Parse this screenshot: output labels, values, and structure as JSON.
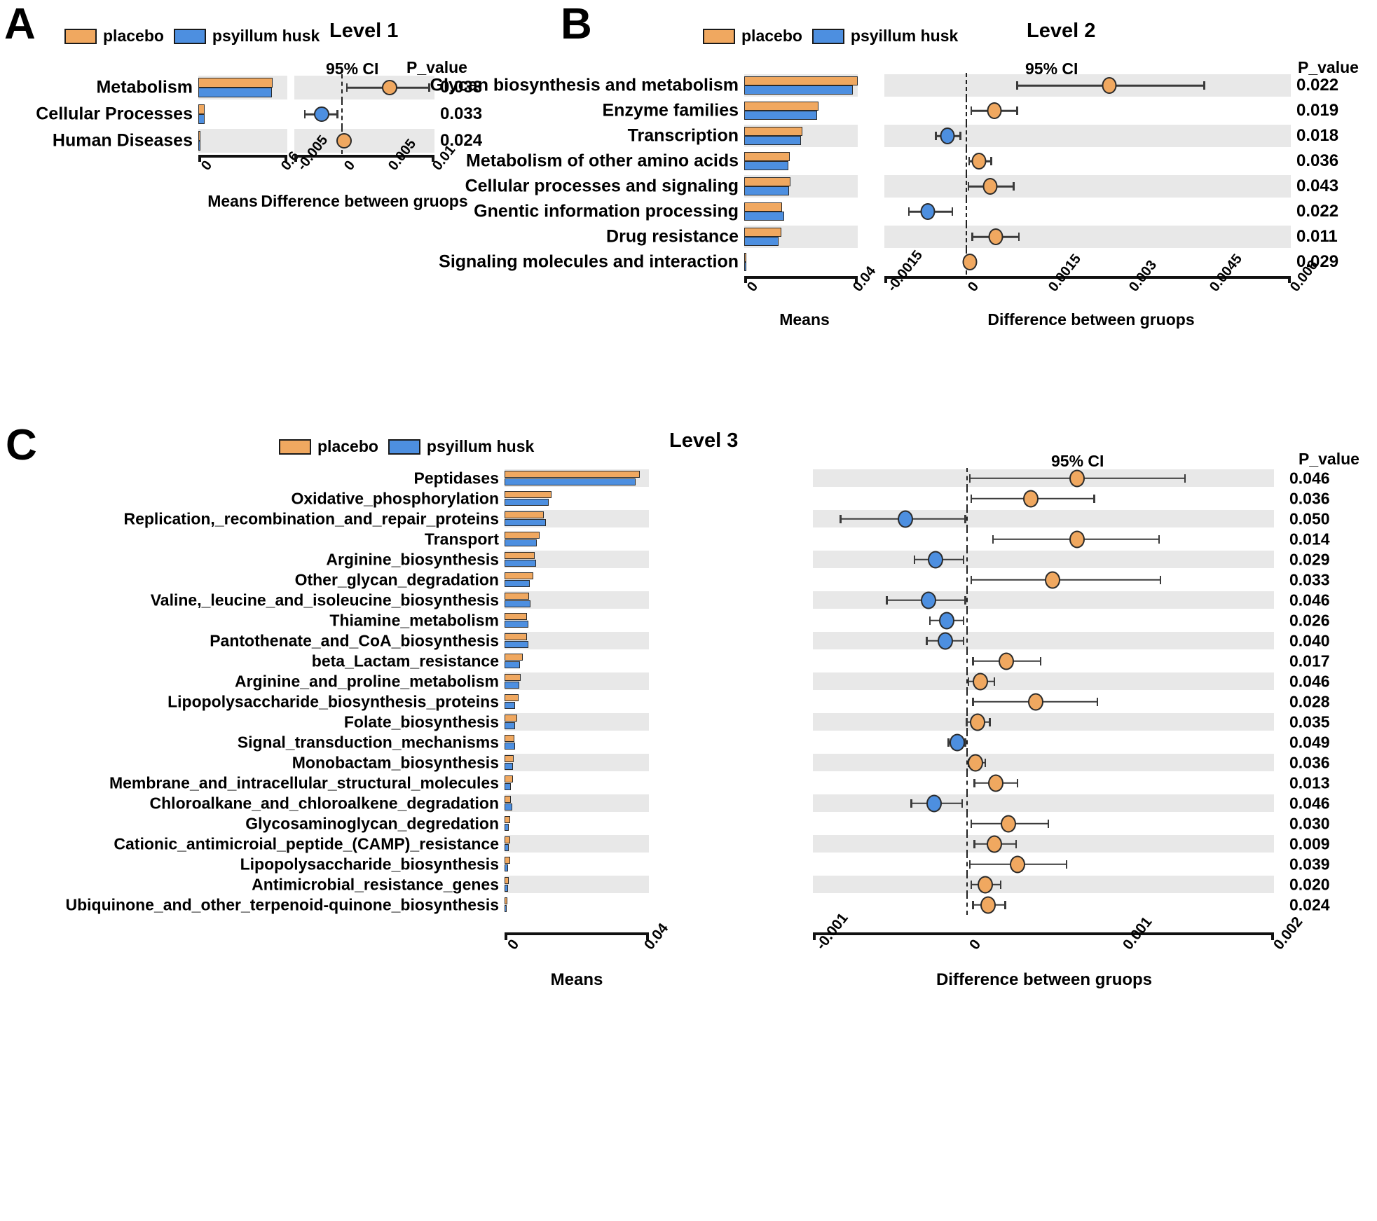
{
  "legend": {
    "placebo": "placebo",
    "psyllium": "psyillum husk",
    "color_placebo": "#F0A860",
    "color_psyllium": "#4D8FE0"
  },
  "labels": {
    "ci_header": "95% CI",
    "p_header": "P_value",
    "means_axis": "Means",
    "diff_axis": "Difference between gruops"
  },
  "panels": {
    "a": {
      "letter": "A",
      "title": "Level 1"
    },
    "b": {
      "letter": "B",
      "title": "Level 2"
    },
    "c": {
      "letter": "C",
      "title": "Level 3"
    }
  },
  "chart_data": [
    {
      "type": "bar",
      "id": "panel-a",
      "title": "Level 1",
      "xlabel": "Means",
      "xlabel2": "Difference between gruops",
      "legend": [
        "placebo",
        "psyillum husk"
      ],
      "means_xlim": [
        0,
        0.6
      ],
      "means_ticks": [
        "0",
        "0.6"
      ],
      "diff_xlim": [
        -0.005,
        0.01
      ],
      "diff_ticks": [
        "-0.005",
        "0",
        "0.005",
        "0.01"
      ],
      "categories": [
        "Metabolism",
        "Cellular Processes",
        "Human Diseases"
      ],
      "series": [
        {
          "name": "placebo",
          "values": [
            0.5,
            0.041,
            0.01
          ]
        },
        {
          "name": "psyillum husk",
          "values": [
            0.495,
            0.043,
            0.008
          ]
        }
      ],
      "effects": [
        {
          "category": "Metabolism",
          "diff": 0.0052,
          "ci_low": 0.0006,
          "ci_high": 0.0094,
          "enriched_in": "placebo",
          "p_value": "0.033"
        },
        {
          "category": "Cellular Processes",
          "diff": -0.0021,
          "ci_low": -0.0039,
          "ci_high": -0.0004,
          "enriched_in": "psyillum husk",
          "p_value": "0.033"
        },
        {
          "category": "Human Diseases",
          "diff": 0.0003,
          "ci_low": 0.0002,
          "ci_high": 0.0004,
          "enriched_in": "placebo",
          "p_value": "0.024"
        }
      ]
    },
    {
      "type": "bar",
      "id": "panel-b",
      "title": "Level 2",
      "xlabel": "Means",
      "xlabel2": "Difference between gruops",
      "legend": [
        "placebo",
        "psyillum husk"
      ],
      "means_xlim": [
        0,
        0.04
      ],
      "means_ticks": [
        "0",
        "0.04"
      ],
      "diff_xlim": [
        -0.0015,
        0.006
      ],
      "diff_ticks": [
        "-0.0015",
        "0",
        "0.0015",
        "0.003",
        "0.0045",
        "0.006"
      ],
      "categories": [
        "Glycan biosynthesis and metabolism",
        "Enzyme families",
        "Transcription",
        "Metabolism of other amino acids",
        "Cellular processes and signaling",
        "Gnentic information processing",
        "Drug resistance",
        "Signaling molecules and interaction"
      ],
      "series": [
        {
          "name": "placebo",
          "values": [
            0.04,
            0.0262,
            0.0205,
            0.016,
            0.0162,
            0.0133,
            0.013,
            0.0008
          ]
        },
        {
          "name": "psyillum husk",
          "values": [
            0.0382,
            0.0258,
            0.02,
            0.0155,
            0.0158,
            0.014,
            0.0122,
            0.0007
          ]
        }
      ],
      "effects": [
        {
          "category": "Glycan biosynthesis and metabolism",
          "diff": 0.00265,
          "ci_low": 0.00095,
          "ci_high": 0.0044,
          "enriched_in": "placebo",
          "p_value": "0.022"
        },
        {
          "category": "Enzyme families",
          "diff": 0.00053,
          "ci_low": 0.0001,
          "ci_high": 0.00095,
          "enriched_in": "placebo",
          "p_value": "0.019"
        },
        {
          "category": "Transcription",
          "diff": -0.00034,
          "ci_low": -0.00055,
          "ci_high": -0.0001,
          "enriched_in": "psyillum husk",
          "p_value": "0.018"
        },
        {
          "category": "Metabolism of other amino acids",
          "diff": 0.00025,
          "ci_low": 6e-05,
          "ci_high": 0.00047,
          "enriched_in": "placebo",
          "p_value": "0.036"
        },
        {
          "category": "Cellular processes and signaling",
          "diff": 0.00045,
          "ci_low": 5e-05,
          "ci_high": 0.00088,
          "enriched_in": "placebo",
          "p_value": "0.043"
        },
        {
          "category": "Gnentic information processing",
          "diff": -0.0007,
          "ci_low": -0.00105,
          "ci_high": -0.00025,
          "enriched_in": "psyillum husk",
          "p_value": "0.022"
        },
        {
          "category": "Drug resistance",
          "diff": 0.00055,
          "ci_low": 0.00012,
          "ci_high": 0.00098,
          "enriched_in": "placebo",
          "p_value": "0.011"
        },
        {
          "category": "Signaling molecules and interaction",
          "diff": 8e-05,
          "ci_low": 3e-05,
          "ci_high": 0.00013,
          "enriched_in": "placebo",
          "p_value": "0.029"
        }
      ]
    },
    {
      "type": "bar",
      "id": "panel-c",
      "title": "Level 3",
      "xlabel": "Means",
      "xlabel2": "Difference between gruops",
      "legend": [
        "placebo",
        "psyillum husk"
      ],
      "means_xlim": [
        0,
        0.04
      ],
      "means_ticks": [
        "0",
        "0.04"
      ],
      "diff_xlim": [
        -0.001,
        0.002
      ],
      "diff_ticks": [
        "-0.001",
        "0",
        "0.001",
        "0.002"
      ],
      "categories": [
        "Peptidases",
        "Oxidative_phosphorylation",
        "Replication,_recombination_and_repair_proteins",
        "Transport",
        "Arginine_biosynthesis",
        "Other_glycan_degradation",
        "Valine,_leucine_and_isoleucine_biosynthesis",
        "Thiamine_metabolism",
        "Pantothenate_and_CoA_biosynthesis",
        "beta_Lactam_resistance",
        "Arginine_and_proline_metabolism",
        "Lipopolysaccharide_biosynthesis_proteins",
        "Folate_biosynthesis",
        "Signal_transduction_mechanisms",
        "Monobactam_biosynthesis",
        "Membrane_and_intracellular_structural_molecules",
        "Chloroalkane_and_chloroalkene_degradation",
        "Glycosaminoglycan_degredation",
        "Cationic_antimicroial_peptide_(CAMP)_resistance",
        "Lipopolysaccharide_biosynthesis",
        "Antimicrobial_resistance_genes",
        "Ubiquinone_and_other_terpenoid-quinone_biosynthesis"
      ],
      "series": [
        {
          "name": "placebo",
          "values": [
            0.0375,
            0.013,
            0.0108,
            0.0098,
            0.0084,
            0.008,
            0.0068,
            0.0063,
            0.0063,
            0.005,
            0.0044,
            0.0038,
            0.0034,
            0.0028,
            0.0026,
            0.0023,
            0.0018,
            0.0016,
            0.0015,
            0.0015,
            0.0012,
            0.0008
          ]
        },
        {
          "name": "psyillum husk",
          "values": [
            0.0363,
            0.0122,
            0.0114,
            0.009,
            0.0088,
            0.007,
            0.0072,
            0.0066,
            0.0066,
            0.0042,
            0.004,
            0.0029,
            0.003,
            0.003,
            0.0023,
            0.0017,
            0.0021,
            0.0011,
            0.0011,
            0.0009,
            0.0009,
            0.0005
          ]
        }
      ],
      "effects": [
        {
          "category": "Peptidases",
          "diff": 0.00072,
          "ci_low": 2e-05,
          "ci_high": 0.00142,
          "enriched_in": "placebo",
          "p_value": "0.046"
        },
        {
          "category": "Oxidative_phosphorylation",
          "diff": 0.00042,
          "ci_low": 3e-05,
          "ci_high": 0.00083,
          "enriched_in": "placebo",
          "p_value": "0.036"
        },
        {
          "category": "Replication,_recombination_and_repair_proteins",
          "diff": -0.0004,
          "ci_low": -0.00082,
          "ci_high": -1e-05,
          "enriched_in": "psyillum husk",
          "p_value": "0.050"
        },
        {
          "category": "Transport",
          "diff": 0.00072,
          "ci_low": 0.00017,
          "ci_high": 0.00125,
          "enriched_in": "placebo",
          "p_value": "0.014"
        },
        {
          "category": "Arginine_biosynthesis",
          "diff": -0.0002,
          "ci_low": -0.00034,
          "ci_high": -2e-05,
          "enriched_in": "psyillum husk",
          "p_value": "0.029"
        },
        {
          "category": "Other_glycan_degradation",
          "diff": 0.00056,
          "ci_low": 3e-05,
          "ci_high": 0.00126,
          "enriched_in": "placebo",
          "p_value": "0.033"
        },
        {
          "category": "Valine,_leucine_and_isoleucine_biosynthesis",
          "diff": -0.00025,
          "ci_low": -0.00052,
          "ci_high": -1e-05,
          "enriched_in": "psyillum husk",
          "p_value": "0.046"
        },
        {
          "category": "Thiamine_metabolism",
          "diff": -0.00013,
          "ci_low": -0.00024,
          "ci_high": -2e-05,
          "enriched_in": "psyillum husk",
          "p_value": "0.026"
        },
        {
          "category": "Pantothenate_and_CoA_biosynthesis",
          "diff": -0.00014,
          "ci_low": -0.00026,
          "ci_high": -2e-05,
          "enriched_in": "psyillum husk",
          "p_value": "0.040"
        },
        {
          "category": "beta_Lactam_resistance",
          "diff": 0.00026,
          "ci_low": 4e-05,
          "ci_high": 0.00048,
          "enriched_in": "placebo",
          "p_value": "0.017"
        },
        {
          "category": "Arginine_and_proline_metabolism",
          "diff": 9e-05,
          "ci_low": 1e-05,
          "ci_high": 0.00018,
          "enriched_in": "placebo",
          "p_value": "0.046"
        },
        {
          "category": "Lipopolysaccharide_biosynthesis_proteins",
          "diff": 0.00045,
          "ci_low": 4e-05,
          "ci_high": 0.00085,
          "enriched_in": "placebo",
          "p_value": "0.028"
        },
        {
          "category": "Folate_biosynthesis",
          "diff": 7e-05,
          "ci_low": 0.0,
          "ci_high": 0.00015,
          "enriched_in": "placebo",
          "p_value": "0.035"
        },
        {
          "category": "Signal_transduction_mechanisms",
          "diff": -6e-05,
          "ci_low": -0.00012,
          "ci_high": -1e-05,
          "enriched_in": "psyillum husk",
          "p_value": "0.049"
        },
        {
          "category": "Monobactam_biosynthesis",
          "diff": 6e-05,
          "ci_low": 1e-05,
          "ci_high": 0.00012,
          "enriched_in": "placebo",
          "p_value": "0.036"
        },
        {
          "category": "Membrane_and_intracellular_structural_molecules",
          "diff": 0.00019,
          "ci_low": 5e-05,
          "ci_high": 0.00033,
          "enriched_in": "placebo",
          "p_value": "0.013"
        },
        {
          "category": "Chloroalkane_and_chloroalkene_degradation",
          "diff": -0.00021,
          "ci_low": -0.00036,
          "ci_high": -3e-05,
          "enriched_in": "psyillum husk",
          "p_value": "0.046"
        },
        {
          "category": "Glycosaminoglycan_degredation",
          "diff": 0.00027,
          "ci_low": 3e-05,
          "ci_high": 0.00053,
          "enriched_in": "placebo",
          "p_value": "0.030"
        },
        {
          "category": "Cationic_antimicroial_peptide_(CAMP)_resistance",
          "diff": 0.00018,
          "ci_low": 5e-05,
          "ci_high": 0.00032,
          "enriched_in": "placebo",
          "p_value": "0.009"
        },
        {
          "category": "Lipopolysaccharide_biosynthesis",
          "diff": 0.00033,
          "ci_low": 2e-05,
          "ci_high": 0.00065,
          "enriched_in": "placebo",
          "p_value": "0.039"
        },
        {
          "category": "Antimicrobial_resistance_genes",
          "diff": 0.00012,
          "ci_low": 3e-05,
          "ci_high": 0.00022,
          "enriched_in": "placebo",
          "p_value": "0.020"
        },
        {
          "category": "Ubiquinone_and_other_terpenoid-quinone_biosynthesis",
          "diff": 0.00014,
          "ci_low": 4e-05,
          "ci_high": 0.00025,
          "enriched_in": "placebo",
          "p_value": "0.024"
        }
      ]
    }
  ]
}
